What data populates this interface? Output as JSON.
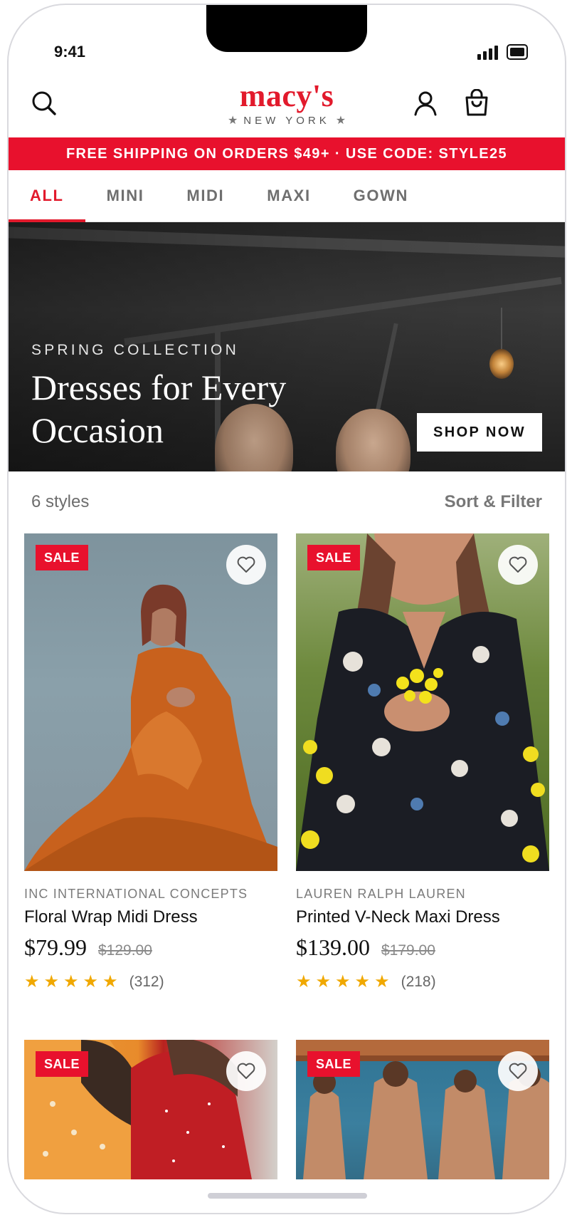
{
  "status": {
    "time": "9:41"
  },
  "header": {
    "logo_main": "macy's",
    "logo_sub": "NEW YORK"
  },
  "promo": {
    "text": "FREE SHIPPING ON ORDERS $49+ · USE CODE: STYLE25"
  },
  "tabs": [
    {
      "label": "ALL",
      "active": true
    },
    {
      "label": "MINI",
      "active": false
    },
    {
      "label": "MIDI",
      "active": false
    },
    {
      "label": "MAXI",
      "active": false
    },
    {
      "label": "GOWN",
      "active": false
    }
  ],
  "hero": {
    "eyebrow": "SPRING COLLECTION",
    "title": "Dresses for Every Occasion",
    "cta": "SHOP NOW"
  },
  "list": {
    "count_label": "6 styles",
    "sort_label": "Sort & Filter"
  },
  "products": [
    {
      "badge": "SALE",
      "brand": "INC INTERNATIONAL CONCEPTS",
      "name": "Floral Wrap Midi Dress",
      "price": "$79.99",
      "original_price": "$129.00",
      "rating": 5,
      "review_count": "(312)"
    },
    {
      "badge": "SALE",
      "brand": "LAUREN RALPH LAUREN",
      "name": "Printed V-Neck Maxi Dress",
      "price": "$139.00",
      "original_price": "$179.00",
      "rating": 5,
      "review_count": "(218)"
    },
    {
      "badge": "SALE"
    },
    {
      "badge": "SALE"
    }
  ],
  "colors": {
    "brand_red": "#e21a2c",
    "promo_red": "#e8112d",
    "star": "#f0a800"
  },
  "icons": [
    "search-icon",
    "account-icon",
    "bag-icon",
    "heart-icon",
    "star-icon",
    "signal-icon",
    "battery-icon"
  ]
}
